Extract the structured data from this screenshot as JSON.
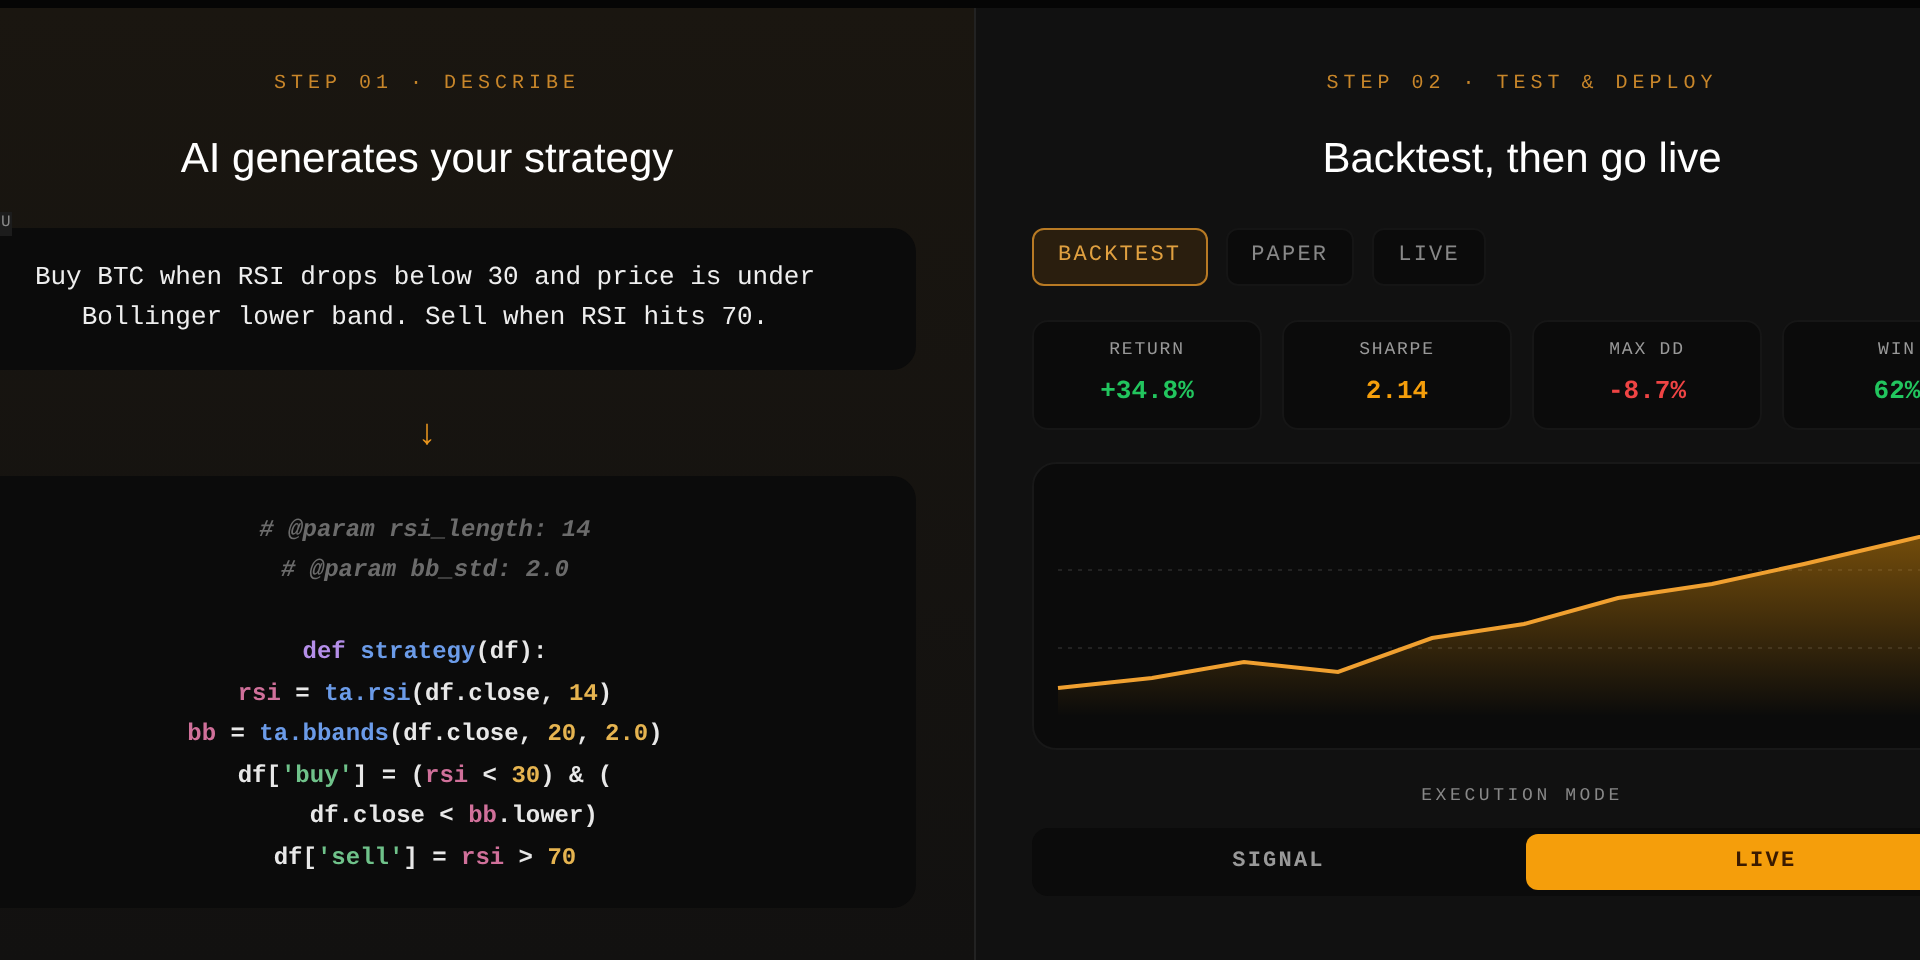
{
  "describe": {
    "step": "STEP 01 · DESCRIBE",
    "title": "AI generates your strategy",
    "prompt_tag": "U",
    "prompt": "Buy BTC when RSI drops below 30 and price is under Bollinger lower band. Sell when RSI hits 70.",
    "arrow": "↓",
    "code": [
      [
        {
          "kind": "comment",
          "text": "# @param rsi_length: 14"
        }
      ],
      [
        {
          "kind": "comment",
          "text": "# @param bb_std: 2.0"
        }
      ],
      [
        {
          "kind": "keyword",
          "text": "def ",
          "gap_before": true
        },
        {
          "kind": "function",
          "text": "strategy"
        },
        {
          "kind": "plain",
          "text": "(df):"
        }
      ],
      [
        {
          "kind": "variable",
          "text": "rsi"
        },
        {
          "kind": "plain",
          "text": " = "
        },
        {
          "kind": "function",
          "text": "ta.rsi"
        },
        {
          "kind": "plain",
          "text": "(df.close, "
        },
        {
          "kind": "number",
          "text": "14"
        },
        {
          "kind": "plain",
          "text": ")"
        }
      ],
      [
        {
          "kind": "variable",
          "text": "bb"
        },
        {
          "kind": "plain",
          "text": " = "
        },
        {
          "kind": "function",
          "text": "ta.bbands"
        },
        {
          "kind": "plain",
          "text": "(df.close, "
        },
        {
          "kind": "number",
          "text": "20"
        },
        {
          "kind": "plain",
          "text": ", "
        },
        {
          "kind": "number",
          "text": "2.0"
        },
        {
          "kind": "plain",
          "text": ")"
        }
      ],
      [
        {
          "kind": "plain",
          "text": "df["
        },
        {
          "kind": "string",
          "text": "'buy'"
        },
        {
          "kind": "plain",
          "text": "] = ("
        },
        {
          "kind": "variable",
          "text": "rsi"
        },
        {
          "kind": "plain",
          "text": " < "
        },
        {
          "kind": "number",
          "text": "30"
        },
        {
          "kind": "plain",
          "text": ") & ("
        }
      ],
      [
        {
          "kind": "plain",
          "text": "    df.close < "
        },
        {
          "kind": "variable",
          "text": "bb"
        },
        {
          "kind": "plain",
          "text": ".lower)"
        }
      ],
      [
        {
          "kind": "plain",
          "text": "df["
        },
        {
          "kind": "string",
          "text": "'sell'"
        },
        {
          "kind": "plain",
          "text": "] = "
        },
        {
          "kind": "variable",
          "text": "rsi"
        },
        {
          "kind": "plain",
          "text": " > "
        },
        {
          "kind": "number",
          "text": "70"
        }
      ]
    ]
  },
  "deploy": {
    "step": "STEP 02 · TEST & DEPLOY",
    "title": "Backtest, then go live",
    "tabs": [
      {
        "label": "BACKTEST",
        "selected": true
      },
      {
        "label": "PAPER",
        "selected": false
      },
      {
        "label": "LIVE",
        "selected": false
      }
    ],
    "stats": [
      {
        "label": "RETURN",
        "value": "+34.8%",
        "color": "#22c55e"
      },
      {
        "label": "SHARPE",
        "value": "2.14",
        "color": "#f59e0b"
      },
      {
        "label": "MAX DD",
        "value": "-8.7%",
        "color": "#ef4444"
      },
      {
        "label": "WIN",
        "value": "62%",
        "color": "#22c55e"
      }
    ],
    "execution_label": "EXECUTION MODE",
    "modes": [
      {
        "label": "SIGNAL",
        "selected": false
      },
      {
        "label": "LIVE",
        "selected": true
      }
    ]
  }
}
